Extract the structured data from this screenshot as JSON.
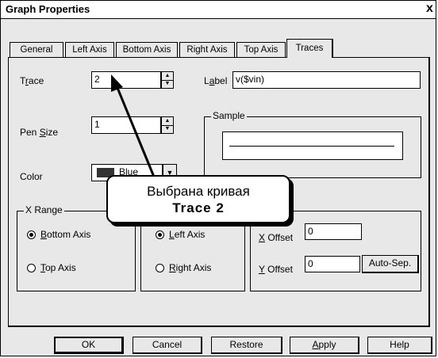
{
  "window": {
    "title": "Graph Properties",
    "close_glyph": "x"
  },
  "tabs": [
    {
      "label": "General"
    },
    {
      "label": "Left Axis"
    },
    {
      "label": "Bottom Axis"
    },
    {
      "label": "Right Axis"
    },
    {
      "label": "Top Axis"
    },
    {
      "label": "Traces",
      "active": true
    }
  ],
  "trace": {
    "trace_label": "Trace",
    "trace_value": "2",
    "label_label": "Label",
    "label_value": "v($vin)",
    "pen_size_label": "Pen Size",
    "pen_size_value": "1",
    "color_label": "Color",
    "color_value": "Blue",
    "color_swatch": "#333333",
    "sample_legend": "Sample"
  },
  "x_range": {
    "legend": "X Range",
    "options": [
      {
        "label": "Bottom Axis",
        "checked": true
      },
      {
        "label": "Top Axis",
        "checked": false
      }
    ]
  },
  "y_range": {
    "options": [
      {
        "label": "Left Axis",
        "checked": true
      },
      {
        "label": "Right Axis",
        "checked": false
      }
    ]
  },
  "offsets": {
    "x_offset_label": "X Offset",
    "x_offset_value": "0",
    "y_offset_label": "Y Offset",
    "y_offset_value": "0",
    "auto_sep_label": "Auto-Sep."
  },
  "buttons": {
    "ok": "OK",
    "cancel": "Cancel",
    "restore": "Restore",
    "apply": "Apply",
    "help": "Help"
  },
  "callout": {
    "line1": "Выбрана кривая",
    "line2": "Trace 2"
  }
}
